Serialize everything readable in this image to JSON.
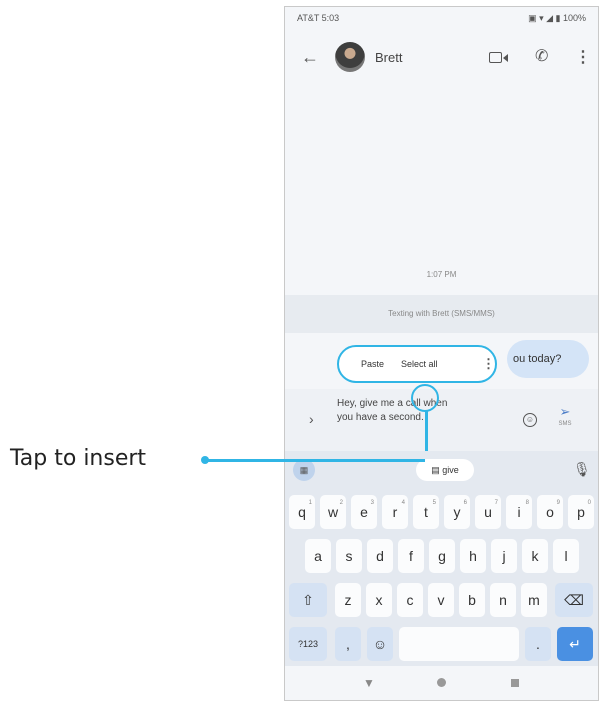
{
  "status_bar": {
    "carrier_time": "AT&T 5:03",
    "indicators": "▣ ▾ ◢ ▮ 100%"
  },
  "app_bar": {
    "back_icon": "arrow-left-icon",
    "contact_name": "Brett",
    "icons": [
      "video-call-icon",
      "phone-icon",
      "more-vert-icon"
    ]
  },
  "conversation": {
    "timestamp": "1:07 PM",
    "texting_notice": "Texting with Brett (SMS/MMS)",
    "visible_message_fragment": "ou today?"
  },
  "context_menu": {
    "paste": "Paste",
    "select_all": "Select all"
  },
  "composer": {
    "text_line1": "Hey, give me a call when",
    "text_line2": "you have a second.",
    "send_label": "SMS"
  },
  "keyboard": {
    "suggestion": "give",
    "row1": [
      "q",
      "w",
      "e",
      "r",
      "t",
      "y",
      "u",
      "i",
      "o",
      "p"
    ],
    "row1_hints": [
      "1",
      "2",
      "3",
      "4",
      "5",
      "6",
      "7",
      "8",
      "9",
      "0"
    ],
    "row2": [
      "a",
      "s",
      "d",
      "f",
      "g",
      "h",
      "j",
      "k",
      "l"
    ],
    "row3": [
      "z",
      "x",
      "c",
      "v",
      "b",
      "n",
      "m"
    ],
    "symbols_key": "?123",
    "comma_key": ",",
    "period_key": "."
  },
  "callout": {
    "label": "Tap to insert"
  },
  "accent_color": "#30b5e5"
}
